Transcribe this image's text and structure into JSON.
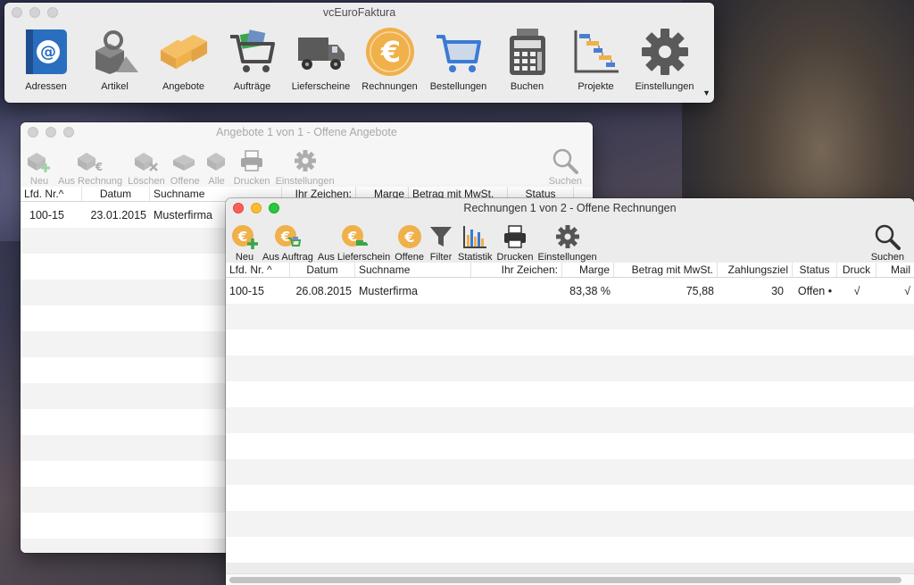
{
  "main_window": {
    "title": "vcEuroFaktura",
    "tools": [
      {
        "label": "Adressen",
        "icon": "address-book-icon"
      },
      {
        "label": "Artikel",
        "icon": "shapes-icon"
      },
      {
        "label": "Angebote",
        "icon": "boxes-icon"
      },
      {
        "label": "Aufträge",
        "icon": "cart-icon"
      },
      {
        "label": "Lieferscheine",
        "icon": "truck-icon"
      },
      {
        "label": "Rechnungen",
        "icon": "euro-icon"
      },
      {
        "label": "Bestellungen",
        "icon": "cart-blue-icon"
      },
      {
        "label": "Buchen",
        "icon": "calculator-icon"
      },
      {
        "label": "Projekte",
        "icon": "gantt-icon"
      },
      {
        "label": "Einstellungen",
        "icon": "gear-icon"
      }
    ]
  },
  "angebote_window": {
    "title": "Angebote 1 von 1  -   Offene Angebote",
    "toolbar": [
      "Neu",
      "Aus Rechnung",
      "Löschen",
      "Offene",
      "Alle",
      "Drucken",
      "Einstellungen"
    ],
    "search_label": "Suchen",
    "columns": [
      "Lfd. Nr.^",
      "Datum",
      "Suchname",
      "Ihr Zeichen:",
      "Marge",
      "Betrag mit MwSt.",
      "Status"
    ],
    "rows": [
      {
        "nr": "100-15",
        "datum": "23.01.2015",
        "suchname": "Musterfirma"
      }
    ]
  },
  "rechnungen_window": {
    "title": "Rechnungen 1 von 2  -   Offene Rechnungen",
    "toolbar": [
      "Neu",
      "Aus Auftrag",
      "Aus Lieferschein",
      "Offene",
      "Filter",
      "Statistik",
      "Drucken",
      "Einstellungen"
    ],
    "search_label": "Suchen",
    "columns": [
      "Lfd. Nr. ^",
      "Datum",
      "Suchname",
      "Ihr Zeichen:",
      "Marge",
      "Betrag mit MwSt.",
      "Zahlungsziel",
      "Status",
      "Druck",
      "Mail"
    ],
    "rows": [
      {
        "nr": "100-15",
        "datum": "26.08.2015",
        "suchname": "Musterfirma",
        "zeichen": "",
        "marge": "83,38 %",
        "betrag": "75,88",
        "ziel": "30",
        "status": "Offen •",
        "druck": "√",
        "mail": "√"
      }
    ]
  },
  "colors": {
    "accent_orange": "#f0b04a",
    "accent_blue": "#3a7bd5",
    "green": "#3aa54b"
  }
}
